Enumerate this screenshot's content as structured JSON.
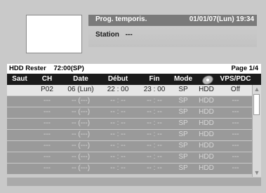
{
  "info": {
    "title": "Prog. temporis.",
    "date": "01/01/07(Lun) 19:34",
    "station_label": "Station",
    "station_value": "---"
  },
  "list": {
    "device": "HDD Rester",
    "remaining": "72:00(SP)",
    "page": "Page 1/4"
  },
  "columns": {
    "saut": "Saut",
    "ch": "CH",
    "date": "Date",
    "debut": "Début",
    "fin": "Fin",
    "mode": "Mode",
    "device_icon": "disc-icon",
    "vps": "VPS/PDC"
  },
  "rows": [
    {
      "saut": "",
      "ch": "P02",
      "date": "06 (Lun)",
      "debut": "22 : 00",
      "fin": "23 : 00",
      "mode": "SP",
      "dev": "HDD",
      "vps": "Off"
    },
    {
      "saut": "",
      "ch": "---",
      "date": "-- (---)",
      "debut": "-- : --",
      "fin": "-- : --",
      "mode": "SP",
      "dev": "HDD",
      "vps": "---"
    },
    {
      "saut": "",
      "ch": "---",
      "date": "-- (---)",
      "debut": "-- : --",
      "fin": "-- : --",
      "mode": "SP",
      "dev": "HDD",
      "vps": "---"
    },
    {
      "saut": "",
      "ch": "---",
      "date": "-- (---)",
      "debut": "-- : --",
      "fin": "-- : --",
      "mode": "SP",
      "dev": "HDD",
      "vps": "---"
    },
    {
      "saut": "",
      "ch": "---",
      "date": "-- (---)",
      "debut": "-- : --",
      "fin": "-- : --",
      "mode": "SP",
      "dev": "HDD",
      "vps": "---"
    },
    {
      "saut": "",
      "ch": "---",
      "date": "-- (---)",
      "debut": "-- : --",
      "fin": "-- : --",
      "mode": "SP",
      "dev": "HDD",
      "vps": "---"
    },
    {
      "saut": "",
      "ch": "---",
      "date": "-- (---)",
      "debut": "-- : --",
      "fin": "-- : --",
      "mode": "SP",
      "dev": "HDD",
      "vps": "---"
    },
    {
      "saut": "",
      "ch": "---",
      "date": "-- (---)",
      "debut": "-- : --",
      "fin": "-- : --",
      "mode": "SP",
      "dev": "HDD",
      "vps": "---"
    }
  ]
}
